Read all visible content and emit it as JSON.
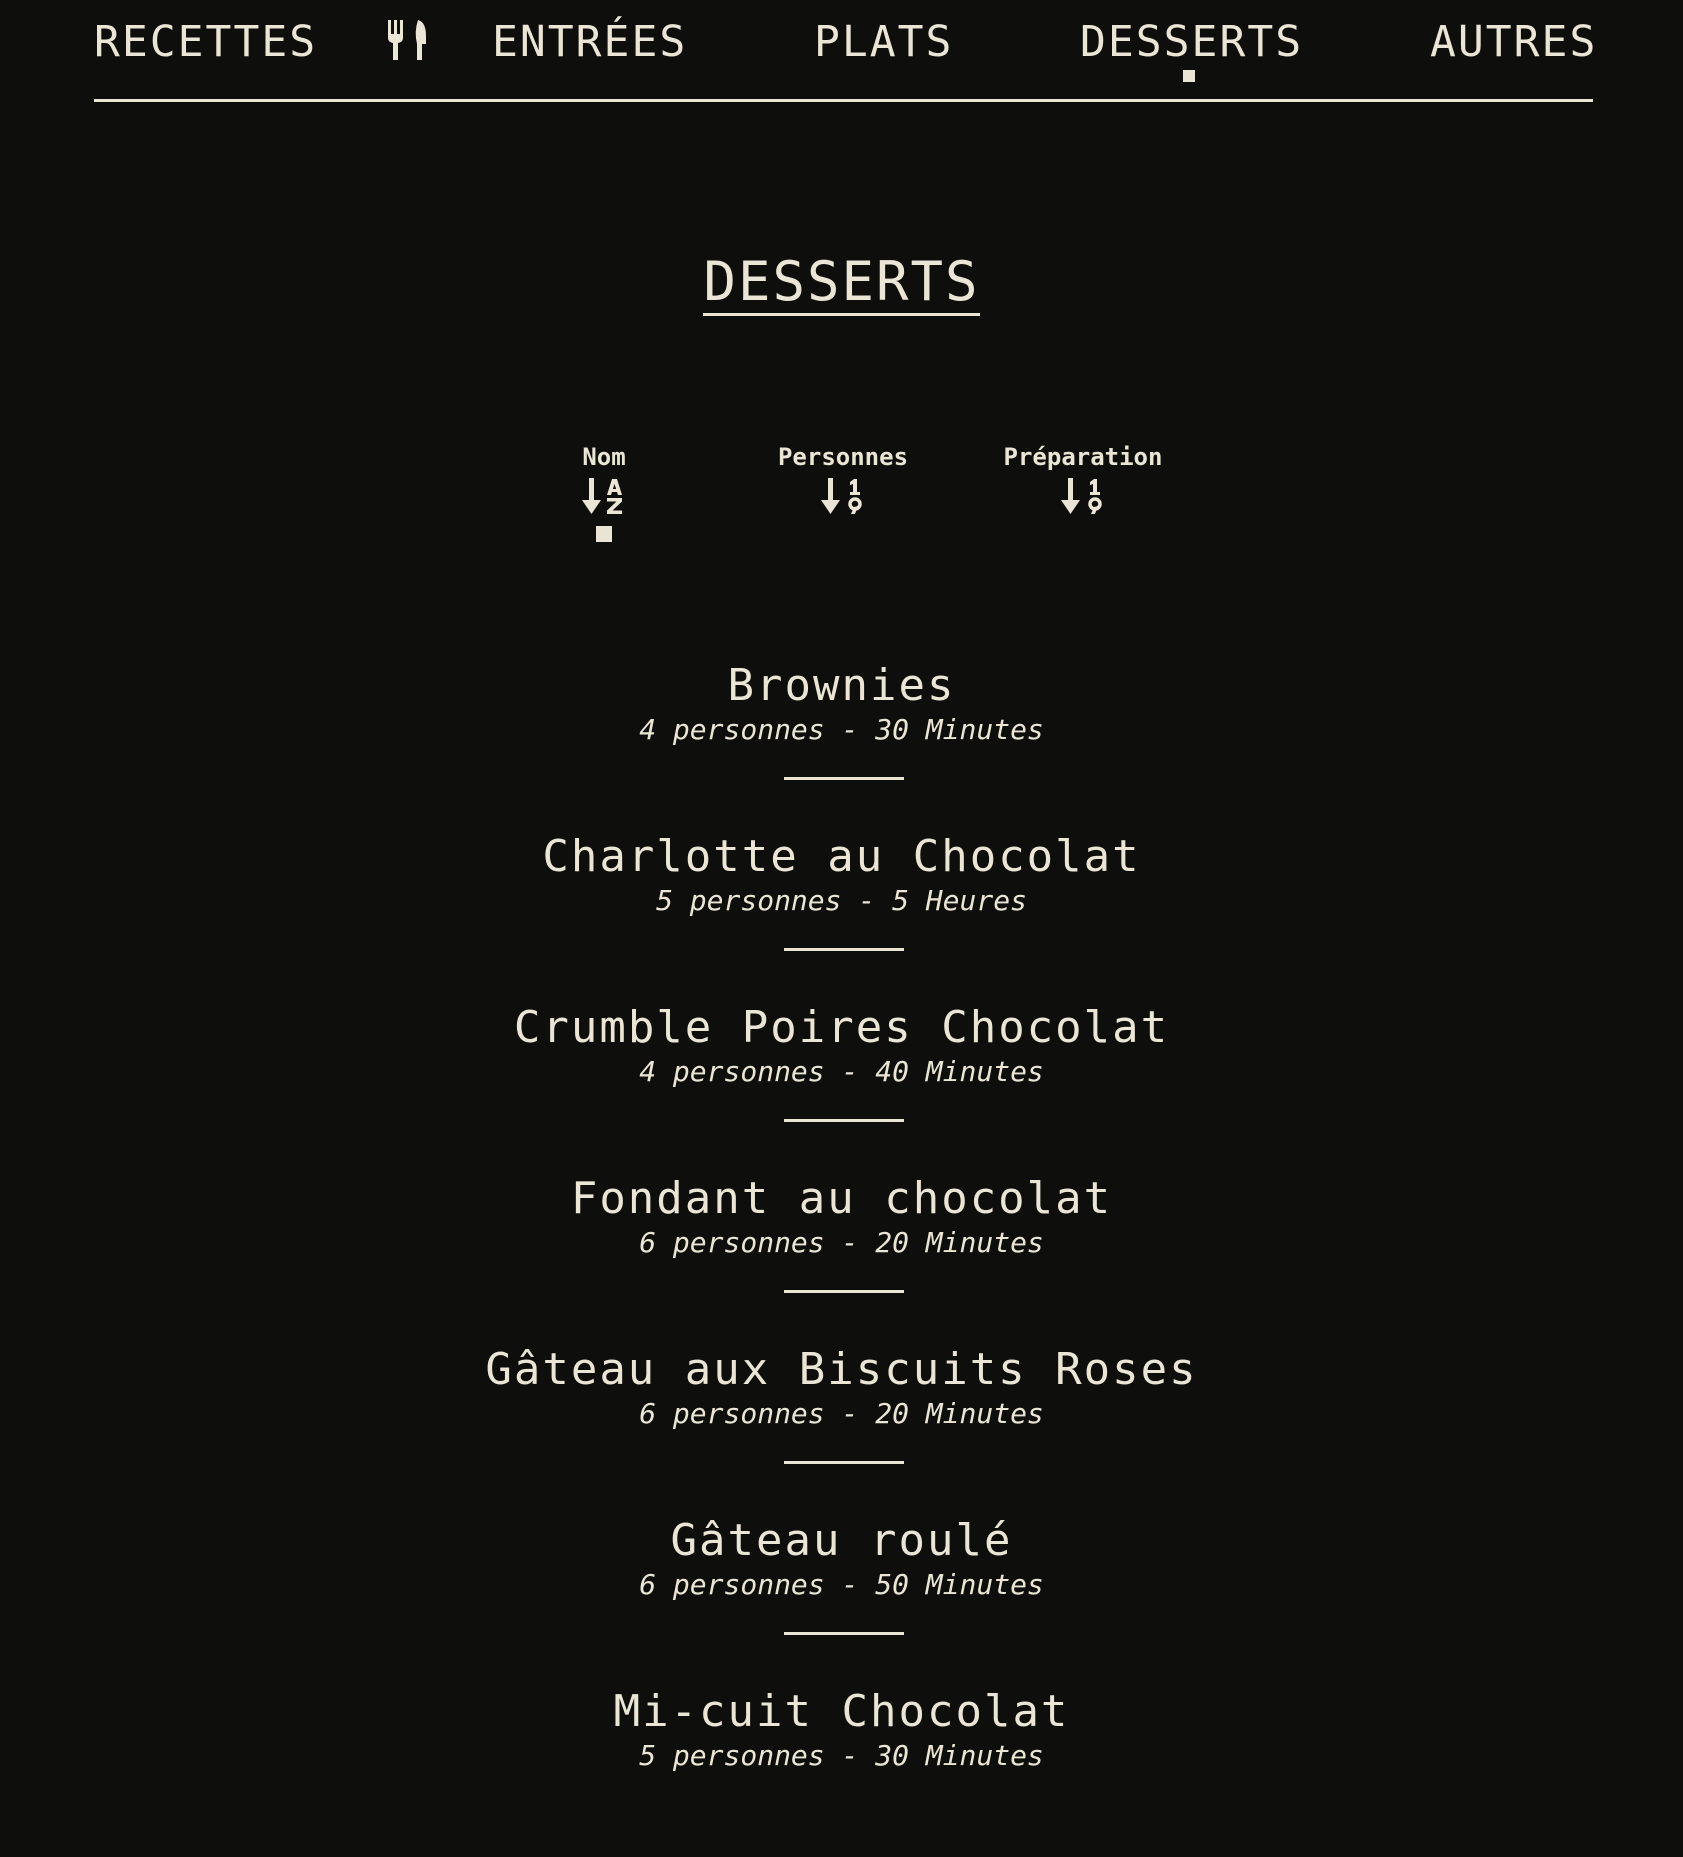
{
  "nav": {
    "brand": "RECETTES",
    "icon": "utensils-icon",
    "items": [
      {
        "label": "ENTRÉES"
      },
      {
        "label": "PLATS"
      },
      {
        "label": "DESSERTS",
        "active": true
      },
      {
        "label": "AUTRES"
      }
    ]
  },
  "page": {
    "title": "DESSERTS"
  },
  "sort": {
    "active": "nom",
    "options": [
      {
        "label": "Nom",
        "icon": "sort-alpha-down-icon"
      },
      {
        "label": "Personnes",
        "icon": "sort-numeric-down-icon"
      },
      {
        "label": "Préparation",
        "icon": "sort-numeric-down-icon"
      }
    ]
  },
  "recipes": [
    {
      "name": "Brownies",
      "persons": "4 personnes",
      "time": "30 Minutes"
    },
    {
      "name": "Charlotte au Chocolat",
      "persons": "5 personnes",
      "time": "5 Heures"
    },
    {
      "name": "Crumble Poires Chocolat",
      "persons": "4 personnes",
      "time": "40 Minutes"
    },
    {
      "name": "Fondant au chocolat",
      "persons": "6 personnes",
      "time": "20 Minutes"
    },
    {
      "name": "Gâteau aux Biscuits Roses",
      "persons": "6 personnes",
      "time": "20 Minutes"
    },
    {
      "name": "Gâteau roulé",
      "persons": "6 personnes",
      "time": "50 Minutes"
    },
    {
      "name": "Mi-cuit Chocolat",
      "persons": "5 personnes",
      "time": "30 Minutes"
    }
  ],
  "meta_separator": " - ",
  "colors": {
    "background": "#0e0e0d",
    "foreground": "#ebe5d5"
  }
}
